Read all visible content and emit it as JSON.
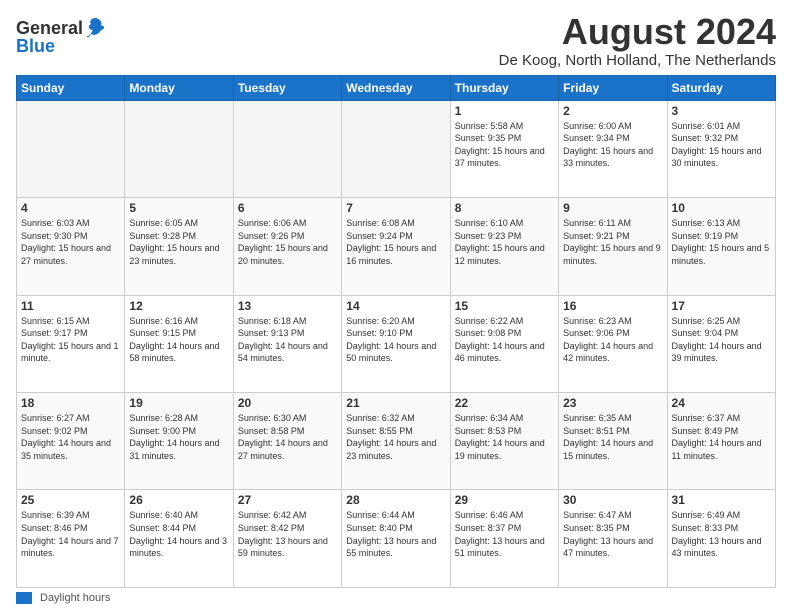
{
  "header": {
    "logo_general": "General",
    "logo_blue": "Blue",
    "month_title": "August 2024",
    "location": "De Koog, North Holland, The Netherlands"
  },
  "weekdays": [
    "Sunday",
    "Monday",
    "Tuesday",
    "Wednesday",
    "Thursday",
    "Friday",
    "Saturday"
  ],
  "footer": {
    "legend_label": "Daylight hours"
  },
  "weeks": [
    [
      {
        "day": "",
        "empty": true
      },
      {
        "day": "",
        "empty": true
      },
      {
        "day": "",
        "empty": true
      },
      {
        "day": "",
        "empty": true
      },
      {
        "day": "1",
        "sunrise": "Sunrise: 5:58 AM",
        "sunset": "Sunset: 9:35 PM",
        "daylight": "Daylight: 15 hours and 37 minutes."
      },
      {
        "day": "2",
        "sunrise": "Sunrise: 6:00 AM",
        "sunset": "Sunset: 9:34 PM",
        "daylight": "Daylight: 15 hours and 33 minutes."
      },
      {
        "day": "3",
        "sunrise": "Sunrise: 6:01 AM",
        "sunset": "Sunset: 9:32 PM",
        "daylight": "Daylight: 15 hours and 30 minutes."
      }
    ],
    [
      {
        "day": "4",
        "sunrise": "Sunrise: 6:03 AM",
        "sunset": "Sunset: 9:30 PM",
        "daylight": "Daylight: 15 hours and 27 minutes."
      },
      {
        "day": "5",
        "sunrise": "Sunrise: 6:05 AM",
        "sunset": "Sunset: 9:28 PM",
        "daylight": "Daylight: 15 hours and 23 minutes."
      },
      {
        "day": "6",
        "sunrise": "Sunrise: 6:06 AM",
        "sunset": "Sunset: 9:26 PM",
        "daylight": "Daylight: 15 hours and 20 minutes."
      },
      {
        "day": "7",
        "sunrise": "Sunrise: 6:08 AM",
        "sunset": "Sunset: 9:24 PM",
        "daylight": "Daylight: 15 hours and 16 minutes."
      },
      {
        "day": "8",
        "sunrise": "Sunrise: 6:10 AM",
        "sunset": "Sunset: 9:23 PM",
        "daylight": "Daylight: 15 hours and 12 minutes."
      },
      {
        "day": "9",
        "sunrise": "Sunrise: 6:11 AM",
        "sunset": "Sunset: 9:21 PM",
        "daylight": "Daylight: 15 hours and 9 minutes."
      },
      {
        "day": "10",
        "sunrise": "Sunrise: 6:13 AM",
        "sunset": "Sunset: 9:19 PM",
        "daylight": "Daylight: 15 hours and 5 minutes."
      }
    ],
    [
      {
        "day": "11",
        "sunrise": "Sunrise: 6:15 AM",
        "sunset": "Sunset: 9:17 PM",
        "daylight": "Daylight: 15 hours and 1 minute."
      },
      {
        "day": "12",
        "sunrise": "Sunrise: 6:16 AM",
        "sunset": "Sunset: 9:15 PM",
        "daylight": "Daylight: 14 hours and 58 minutes."
      },
      {
        "day": "13",
        "sunrise": "Sunrise: 6:18 AM",
        "sunset": "Sunset: 9:13 PM",
        "daylight": "Daylight: 14 hours and 54 minutes."
      },
      {
        "day": "14",
        "sunrise": "Sunrise: 6:20 AM",
        "sunset": "Sunset: 9:10 PM",
        "daylight": "Daylight: 14 hours and 50 minutes."
      },
      {
        "day": "15",
        "sunrise": "Sunrise: 6:22 AM",
        "sunset": "Sunset: 9:08 PM",
        "daylight": "Daylight: 14 hours and 46 minutes."
      },
      {
        "day": "16",
        "sunrise": "Sunrise: 6:23 AM",
        "sunset": "Sunset: 9:06 PM",
        "daylight": "Daylight: 14 hours and 42 minutes."
      },
      {
        "day": "17",
        "sunrise": "Sunrise: 6:25 AM",
        "sunset": "Sunset: 9:04 PM",
        "daylight": "Daylight: 14 hours and 39 minutes."
      }
    ],
    [
      {
        "day": "18",
        "sunrise": "Sunrise: 6:27 AM",
        "sunset": "Sunset: 9:02 PM",
        "daylight": "Daylight: 14 hours and 35 minutes."
      },
      {
        "day": "19",
        "sunrise": "Sunrise: 6:28 AM",
        "sunset": "Sunset: 9:00 PM",
        "daylight": "Daylight: 14 hours and 31 minutes."
      },
      {
        "day": "20",
        "sunrise": "Sunrise: 6:30 AM",
        "sunset": "Sunset: 8:58 PM",
        "daylight": "Daylight: 14 hours and 27 minutes."
      },
      {
        "day": "21",
        "sunrise": "Sunrise: 6:32 AM",
        "sunset": "Sunset: 8:55 PM",
        "daylight": "Daylight: 14 hours and 23 minutes."
      },
      {
        "day": "22",
        "sunrise": "Sunrise: 6:34 AM",
        "sunset": "Sunset: 8:53 PM",
        "daylight": "Daylight: 14 hours and 19 minutes."
      },
      {
        "day": "23",
        "sunrise": "Sunrise: 6:35 AM",
        "sunset": "Sunset: 8:51 PM",
        "daylight": "Daylight: 14 hours and 15 minutes."
      },
      {
        "day": "24",
        "sunrise": "Sunrise: 6:37 AM",
        "sunset": "Sunset: 8:49 PM",
        "daylight": "Daylight: 14 hours and 11 minutes."
      }
    ],
    [
      {
        "day": "25",
        "sunrise": "Sunrise: 6:39 AM",
        "sunset": "Sunset: 8:46 PM",
        "daylight": "Daylight: 14 hours and 7 minutes."
      },
      {
        "day": "26",
        "sunrise": "Sunrise: 6:40 AM",
        "sunset": "Sunset: 8:44 PM",
        "daylight": "Daylight: 14 hours and 3 minutes."
      },
      {
        "day": "27",
        "sunrise": "Sunrise: 6:42 AM",
        "sunset": "Sunset: 8:42 PM",
        "daylight": "Daylight: 13 hours and 59 minutes."
      },
      {
        "day": "28",
        "sunrise": "Sunrise: 6:44 AM",
        "sunset": "Sunset: 8:40 PM",
        "daylight": "Daylight: 13 hours and 55 minutes."
      },
      {
        "day": "29",
        "sunrise": "Sunrise: 6:46 AM",
        "sunset": "Sunset: 8:37 PM",
        "daylight": "Daylight: 13 hours and 51 minutes."
      },
      {
        "day": "30",
        "sunrise": "Sunrise: 6:47 AM",
        "sunset": "Sunset: 8:35 PM",
        "daylight": "Daylight: 13 hours and 47 minutes."
      },
      {
        "day": "31",
        "sunrise": "Sunrise: 6:49 AM",
        "sunset": "Sunset: 8:33 PM",
        "daylight": "Daylight: 13 hours and 43 minutes."
      }
    ]
  ]
}
